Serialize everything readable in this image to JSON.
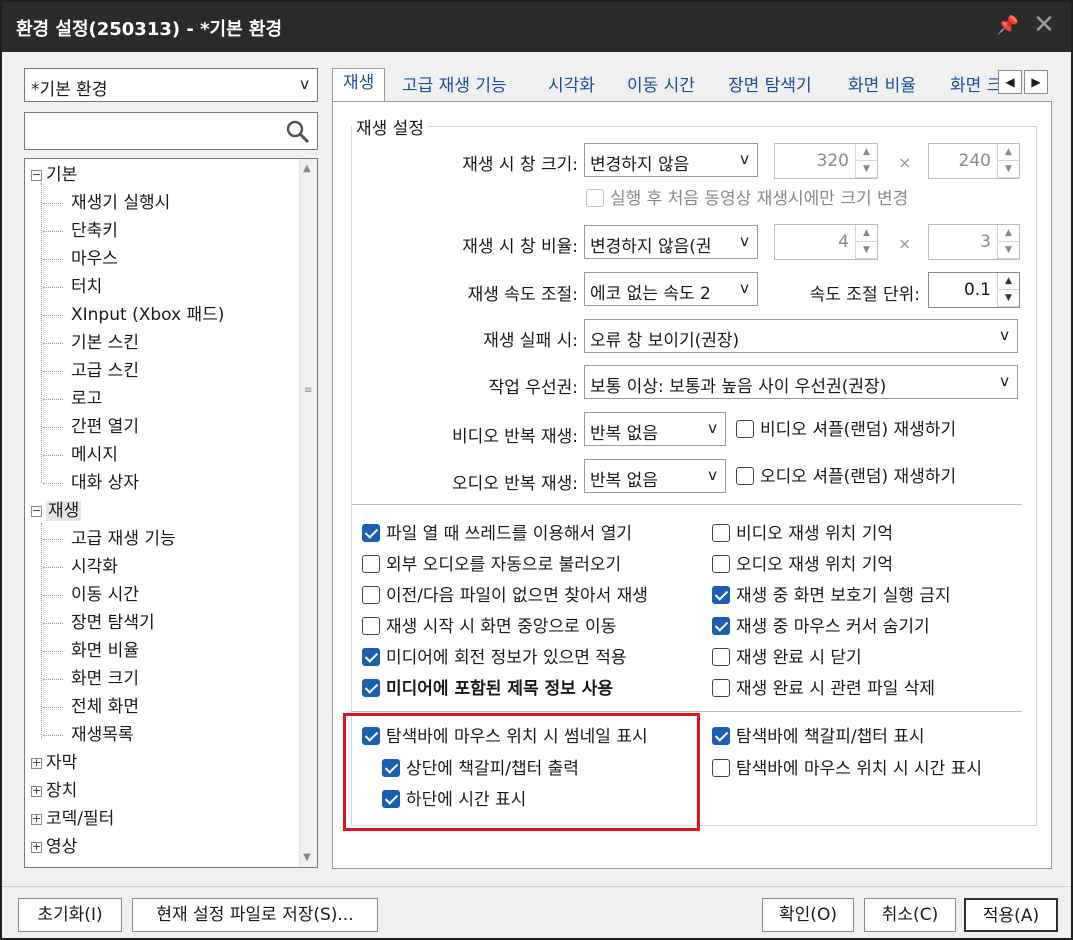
{
  "window": {
    "title": "환경 설정(250313) - *기본 환경"
  },
  "profile": {
    "value": "*기본 환경",
    "arrow": "v"
  },
  "search": {
    "value": ""
  },
  "tree": {
    "basic": {
      "label": "기본",
      "children": [
        "재생기 실행시",
        "단축키",
        "마우스",
        "터치",
        "XInput (Xbox 패드)",
        "기본 스킨",
        "고급 스킨",
        "로고",
        "간편 열기",
        "메시지",
        "대화 상자"
      ]
    },
    "play": {
      "label": "재생",
      "children": [
        "고급 재생 기능",
        "시각화",
        "이동 시간",
        "장면 탐색기",
        "화면 비율",
        "화면 크기",
        "전체 화면",
        "재생목록"
      ]
    },
    "collapsed": [
      "자막",
      "장치",
      "코덱/필터",
      "영상"
    ]
  },
  "tabs": [
    "재생",
    "고급 재생 기능",
    "시각화",
    "이동 시간",
    "장면 탐색기",
    "화면 비율",
    "화면 크"
  ],
  "group": {
    "title": "재생 설정"
  },
  "fields": {
    "window_size": {
      "label": "재생 시 창 크기:",
      "value": "변경하지 않음",
      "arrow": "v",
      "w": "320",
      "h": "240",
      "times": "×"
    },
    "first_play_only": {
      "label": "실행 후 처음 동영상 재생시에만 크기 변경"
    },
    "window_ratio": {
      "label": "재생 시 창 비율:",
      "value": "변경하지 않음(권",
      "arrow": "v",
      "w": "4",
      "h": "3",
      "times": "×"
    },
    "speed": {
      "label": "재생 속도 조절:",
      "value": "에코 없는 속도 2",
      "arrow": "v",
      "unit_label": "속도 조절 단위:",
      "unit_value": "0.1"
    },
    "fail": {
      "label": "재생 실패 시:",
      "value": "오류 창 보이기(권장)",
      "arrow": "v"
    },
    "priority": {
      "label": "작업 우선권:",
      "value": "보통 이상: 보통과 높음 사이 우선권(권장)",
      "arrow": "v"
    },
    "video_repeat": {
      "label": "비디오 반복 재생:",
      "value": "반복 없음",
      "arrow": "v",
      "shuffle": "비디오 셔플(랜덤) 재생하기"
    },
    "audio_repeat": {
      "label": "오디오 반복 재생:",
      "value": "반복 없음",
      "arrow": "v",
      "shuffle": "오디오 셔플(랜덤) 재생하기"
    }
  },
  "checks_left": [
    {
      "label": "파일 열 때 쓰레드를 이용해서 열기",
      "checked": true
    },
    {
      "label": "외부 오디오를 자동으로 불러오기",
      "checked": false
    },
    {
      "label": "이전/다음 파일이 없으면 찾아서 재생",
      "checked": false
    },
    {
      "label": "재생 시작 시 화면 중앙으로 이동",
      "checked": false
    },
    {
      "label": "미디어에 회전 정보가 있으면 적용",
      "checked": true
    },
    {
      "label": "미디어에 포함된 제목 정보 사용",
      "checked": true
    }
  ],
  "checks_right": [
    {
      "label": "비디오 재생 위치 기억",
      "checked": false
    },
    {
      "label": "오디오 재생 위치 기억",
      "checked": false
    },
    {
      "label": "재생 중 화면 보호기 실행 금지",
      "checked": true
    },
    {
      "label": "재생 중 마우스 커서 숨기기",
      "checked": true
    },
    {
      "label": "재생 완료 시 닫기",
      "checked": false
    },
    {
      "label": "재생 완료 시 관련 파일 삭제",
      "checked": false
    }
  ],
  "seekbar": {
    "thumb": "탐색바에 마우스 위치 시 썸네일 표시",
    "top_chapter": "상단에 책갈피/챕터 출력",
    "bottom_time": "하단에 시간 표시",
    "chapter": "탐색바에 책갈피/챕터 표시",
    "time": "탐색바에 마우스 위치 시 시간 표시"
  },
  "buttons": {
    "reset": "초기화(I)",
    "save": "현재 설정 파일로 저장(S)...",
    "ok": "확인(O)",
    "cancel": "취소(C)",
    "apply": "적용(A)"
  },
  "colors": {
    "accent": "#1a5fb4",
    "highlight": "#e0141e",
    "titlebar": "#2b2b2b"
  }
}
